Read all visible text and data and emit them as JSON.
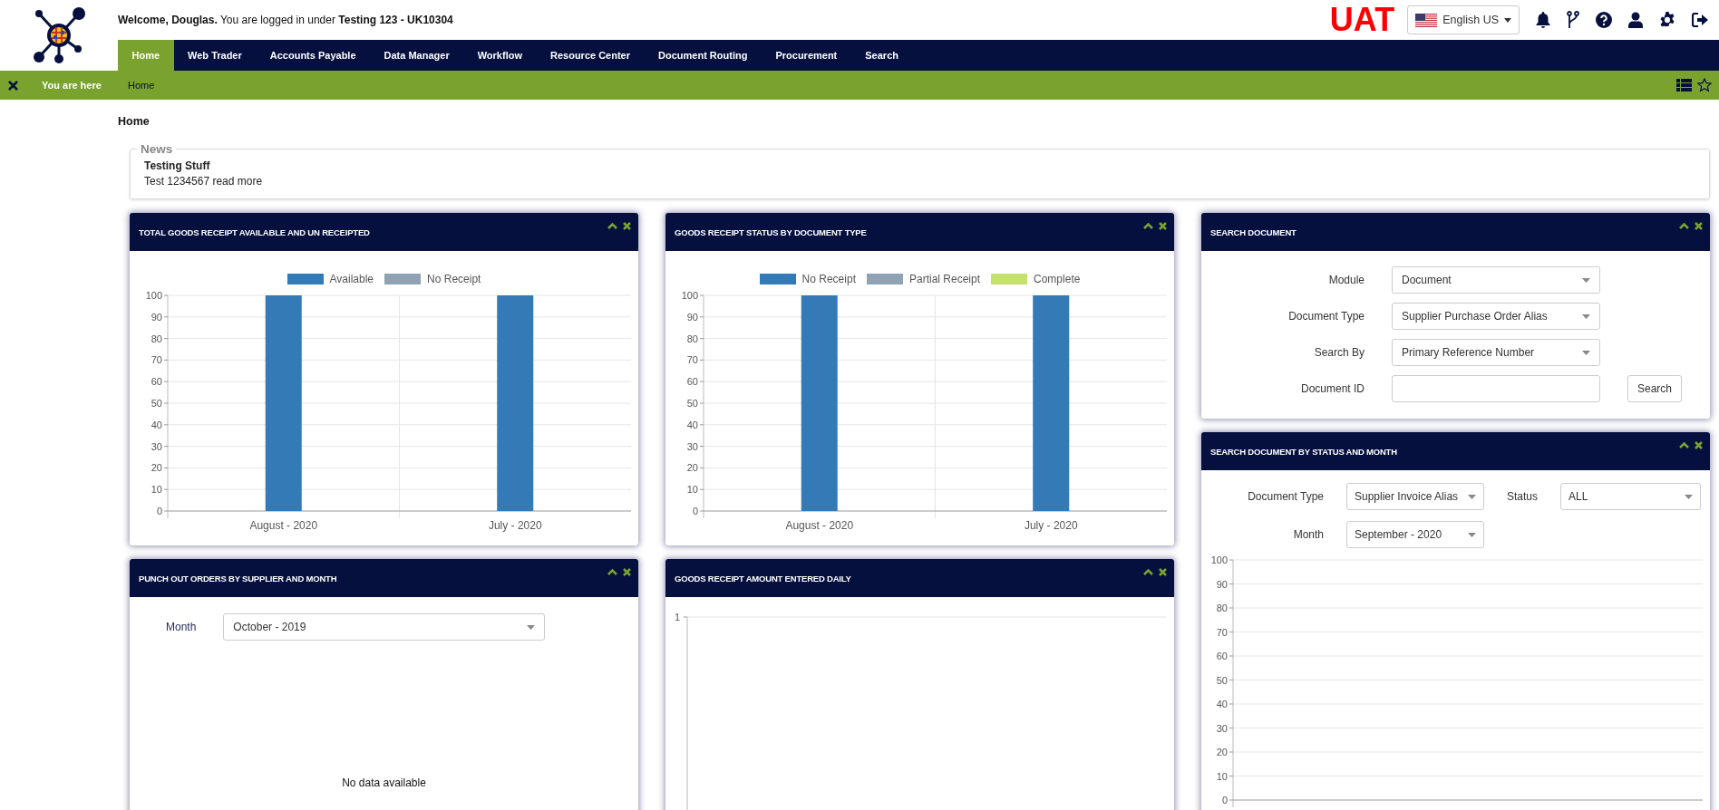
{
  "header": {
    "welcome": "**Welcome, Douglas.** You are logged in under **Testing 123 - UK10304**",
    "environment": "UAT",
    "language": "English US"
  },
  "nav": [
    {
      "label": "Home",
      "selected": true
    },
    {
      "label": "Web Trader",
      "selected": false
    },
    {
      "label": "Accounts Payable",
      "selected": false
    },
    {
      "label": "Data Manager",
      "selected": false
    },
    {
      "label": "Workflow",
      "selected": false
    },
    {
      "label": "Resource Center",
      "selected": false
    },
    {
      "label": "Document Routing",
      "selected": false
    },
    {
      "label": "Procurement",
      "selected": false
    },
    {
      "label": "Search",
      "selected": false
    }
  ],
  "breadcrumb": {
    "label": "You are here",
    "current": "Home"
  },
  "page_title": "Home",
  "news": {
    "legend": "News",
    "items": [
      {
        "title": "Testing Stuff",
        "text": "Test 1234567 read more"
      }
    ]
  },
  "columns": [
    {
      "widgets": [
        {
          "kind": "bar_chart",
          "title": "TOTAL GOODS RECEIPT AVAILABLE AND UN RECEIPTED",
          "chart_data": {
            "type": "bar",
            "categories": [
              "August - 2020",
              "July - 2020"
            ],
            "series": [
              {
                "name": "Available",
                "color": "#337ab7",
                "values": [
                  100,
                  100
                ]
              },
              {
                "name": "No Receipt",
                "color": "#8fa3b4",
                "values": [
                  0,
                  0
                ]
              }
            ],
            "ylim": [
              0,
              100
            ],
            "yticks": [
              0,
              10,
              20,
              30,
              40,
              50,
              60,
              70,
              80,
              90,
              100
            ],
            "grid": true
          }
        },
        {
          "kind": "punchout",
          "title": "PUNCH OUT ORDERS BY SUPPLIER AND MONTH",
          "fields": [
            {
              "label": "Month",
              "kind": "select",
              "value": "October - 2019"
            }
          ],
          "message": "No data available"
        }
      ]
    },
    {
      "widgets": [
        {
          "kind": "bar_chart",
          "title": "GOODS RECEIPT STATUS BY DOCUMENT TYPE",
          "chart_data": {
            "type": "bar",
            "categories": [
              "August - 2020",
              "July - 2020"
            ],
            "series": [
              {
                "name": "No Receipt",
                "color": "#337ab7",
                "values": [
                  100,
                  100
                ]
              },
              {
                "name": "Partial Receipt",
                "color": "#8fa3b4",
                "values": [
                  0,
                  0
                ]
              },
              {
                "name": "Complete",
                "color": "#c5e26d",
                "values": [
                  0,
                  0
                ]
              }
            ],
            "ylim": [
              0,
              100
            ],
            "yticks": [
              0,
              10,
              20,
              30,
              40,
              50,
              60,
              70,
              80,
              90,
              100
            ],
            "grid": true
          }
        },
        {
          "kind": "daily_chart",
          "title": "GOODS RECEIPT AMOUNT ENTERED DAILY",
          "axis_label": "1"
        }
      ]
    },
    {
      "widgets": [
        {
          "kind": "search_form",
          "title": "SEARCH DOCUMENT",
          "fields": [
            {
              "label": "Module",
              "kind": "select",
              "value": "Document"
            },
            {
              "label": "Document Type",
              "kind": "select",
              "value": "Supplier Purchase Order Alias"
            },
            {
              "label": "Search By",
              "kind": "select",
              "value": "Primary Reference Number"
            },
            {
              "label": "Document ID",
              "kind": "text"
            }
          ],
          "button": "Search"
        },
        {
          "kind": "status_search",
          "title": "SEARCH DOCUMENT BY STATUS AND MONTH",
          "fields": [
            {
              "label": "Document Type",
              "kind": "select",
              "value": "Supplier Invoice Alias"
            },
            {
              "label": "Status",
              "kind": "select",
              "value": "ALL"
            },
            {
              "label": "Month",
              "kind": "select",
              "value": "September - 2020"
            }
          ],
          "chart_data": {
            "type": "bar",
            "categories": [
              null
            ],
            "values": [
              null
            ],
            "ylim": [
              0,
              100
            ],
            "yticks": [
              0,
              10,
              20,
              30,
              40,
              50,
              60,
              70,
              80,
              90,
              100
            ],
            "grid": true
          }
        }
      ]
    }
  ]
}
